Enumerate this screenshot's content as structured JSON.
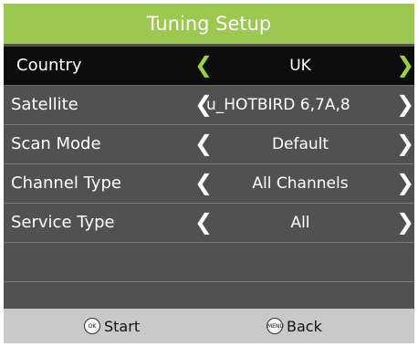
{
  "header": {
    "title": "Tuning Setup"
  },
  "menu": {
    "items": [
      {
        "label": "Country",
        "value": "UK",
        "left_arrow": "❮",
        "right_arrow": "❯"
      },
      {
        "label": "Satellite",
        "value": "u_HOTBIRD 6,7A,8",
        "left_arrow": "❮",
        "right_arrow": "❯"
      },
      {
        "label": "Scan Mode",
        "value": "Default",
        "left_arrow": "❮",
        "right_arrow": "❯"
      },
      {
        "label": "Channel Type",
        "value": "All Channels",
        "left_arrow": "❮",
        "right_arrow": "❯"
      },
      {
        "label": "Service Type",
        "value": "All",
        "left_arrow": "❮",
        "right_arrow": "❯"
      }
    ],
    "selected_index": 0
  },
  "footer": {
    "ok_key": "OK",
    "ok_label": "Start",
    "menu_key": "MENU",
    "menu_label": "Back"
  },
  "colors": {
    "accent": "#9bc94f",
    "selected_arrow": "#9bd13a",
    "panel": "#515151",
    "selected_row": "#0c0c0c",
    "footer": "#c9c9c9"
  }
}
